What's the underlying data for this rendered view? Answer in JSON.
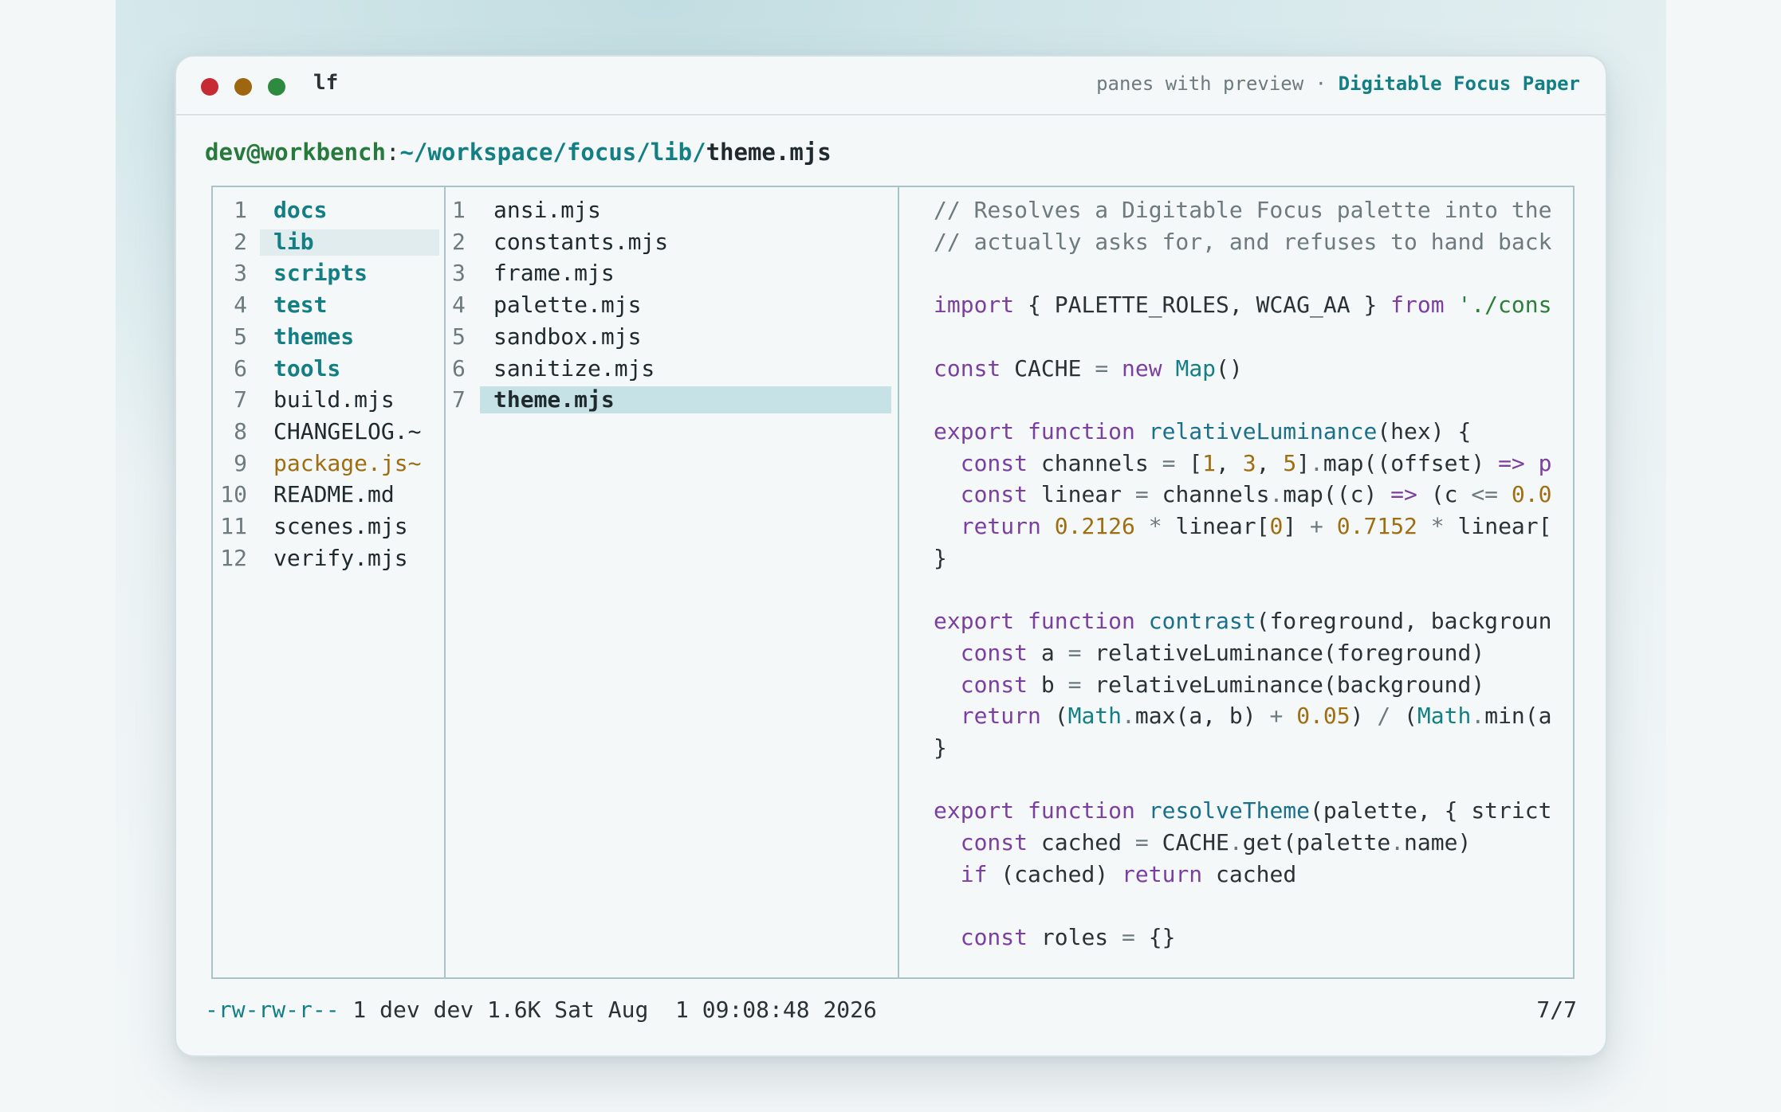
{
  "window": {
    "app_title": "lf",
    "subtitle": "panes with preview",
    "separator": "·",
    "theme_name": "Digitable Focus Paper"
  },
  "prompt": {
    "user_host": "dev@workbench",
    "colon": ":",
    "dir_path": "~/workspace/focus/lib/",
    "file": "theme.mjs"
  },
  "parent_pane": {
    "items": [
      {
        "num": "1",
        "name": "docs",
        "kind": "dir"
      },
      {
        "num": "2",
        "name": "lib",
        "kind": "dir",
        "current": true
      },
      {
        "num": "3",
        "name": "scripts",
        "kind": "dir"
      },
      {
        "num": "4",
        "name": "test",
        "kind": "dir"
      },
      {
        "num": "5",
        "name": "themes",
        "kind": "dir"
      },
      {
        "num": "6",
        "name": "tools",
        "kind": "dir"
      },
      {
        "num": "7",
        "name": "build.mjs",
        "kind": "file"
      },
      {
        "num": "8",
        "name": "CHANGELOG.~",
        "kind": "file"
      },
      {
        "num": "9",
        "name": "package.js~",
        "kind": "modified"
      },
      {
        "num": "10",
        "name": "README.md",
        "kind": "file"
      },
      {
        "num": "11",
        "name": "scenes.mjs",
        "kind": "file"
      },
      {
        "num": "12",
        "name": "verify.mjs",
        "kind": "file"
      }
    ]
  },
  "current_pane": {
    "items": [
      {
        "num": "1",
        "name": "ansi.mjs"
      },
      {
        "num": "2",
        "name": "constants.mjs"
      },
      {
        "num": "3",
        "name": "frame.mjs"
      },
      {
        "num": "4",
        "name": "palette.mjs"
      },
      {
        "num": "5",
        "name": "sandbox.mjs"
      },
      {
        "num": "6",
        "name": "sanitize.mjs"
      },
      {
        "num": "7",
        "name": "theme.mjs",
        "selected": true
      }
    ]
  },
  "preview": {
    "lines": [
      [
        [
          "c-com",
          "// Resolves a Digitable Focus palette into the"
        ]
      ],
      [
        [
          "c-com",
          "// actually asks for, and refuses to hand back"
        ]
      ],
      [],
      [
        [
          "c-kw",
          "import"
        ],
        [
          "",
          " { PALETTE_ROLES, WCAG_AA } "
        ],
        [
          "c-kw",
          "from"
        ],
        [
          "",
          " "
        ],
        [
          "c-str",
          "'./cons"
        ]
      ],
      [],
      [
        [
          "c-kw",
          "const"
        ],
        [
          "",
          " CACHE "
        ],
        [
          "c-op",
          "="
        ],
        [
          "",
          " "
        ],
        [
          "c-kw",
          "new"
        ],
        [
          "",
          " "
        ],
        [
          "c-ty",
          "Map"
        ],
        [
          "",
          "()"
        ]
      ],
      [],
      [
        [
          "c-kw",
          "export"
        ],
        [
          "",
          " "
        ],
        [
          "c-kw",
          "function"
        ],
        [
          "",
          " "
        ],
        [
          "c-fn",
          "relativeLuminance"
        ],
        [
          "",
          "(hex) {"
        ]
      ],
      [
        [
          "",
          "  "
        ],
        [
          "c-kw",
          "const"
        ],
        [
          "",
          " channels "
        ],
        [
          "c-op",
          "="
        ],
        [
          "",
          " ["
        ],
        [
          "c-num",
          "1"
        ],
        [
          "",
          ", "
        ],
        [
          "c-num",
          "3"
        ],
        [
          "",
          ", "
        ],
        [
          "c-num",
          "5"
        ],
        [
          "",
          "]"
        ],
        [
          "c-op",
          "."
        ],
        [
          "",
          "map((offset) "
        ],
        [
          "c-kw",
          "=>"
        ],
        [
          "",
          " "
        ],
        [
          "c-kw",
          "p"
        ]
      ],
      [
        [
          "",
          "  "
        ],
        [
          "c-kw",
          "const"
        ],
        [
          "",
          " linear "
        ],
        [
          "c-op",
          "="
        ],
        [
          "",
          " channels"
        ],
        [
          "c-op",
          "."
        ],
        [
          "",
          "map((c) "
        ],
        [
          "c-kw",
          "=>"
        ],
        [
          "",
          " (c "
        ],
        [
          "c-op",
          "<="
        ],
        [
          "",
          " "
        ],
        [
          "c-num",
          "0.0"
        ]
      ],
      [
        [
          "",
          "  "
        ],
        [
          "c-kw",
          "return"
        ],
        [
          "",
          " "
        ],
        [
          "c-num",
          "0.2126"
        ],
        [
          "",
          " "
        ],
        [
          "c-op",
          "*"
        ],
        [
          "",
          " linear["
        ],
        [
          "c-num",
          "0"
        ],
        [
          "",
          "] "
        ],
        [
          "c-op",
          "+"
        ],
        [
          "",
          " "
        ],
        [
          "c-num",
          "0.7152"
        ],
        [
          "",
          " "
        ],
        [
          "c-op",
          "*"
        ],
        [
          "",
          " linear["
        ]
      ],
      [
        [
          "",
          "}"
        ]
      ],
      [],
      [
        [
          "c-kw",
          "export"
        ],
        [
          "",
          " "
        ],
        [
          "c-kw",
          "function"
        ],
        [
          "",
          " "
        ],
        [
          "c-fn",
          "contrast"
        ],
        [
          "",
          "(foreground, backgroun"
        ]
      ],
      [
        [
          "",
          "  "
        ],
        [
          "c-kw",
          "const"
        ],
        [
          "",
          " a "
        ],
        [
          "c-op",
          "="
        ],
        [
          "",
          " relativeLuminance(foreground)"
        ]
      ],
      [
        [
          "",
          "  "
        ],
        [
          "c-kw",
          "const"
        ],
        [
          "",
          " b "
        ],
        [
          "c-op",
          "="
        ],
        [
          "",
          " relativeLuminance(background)"
        ]
      ],
      [
        [
          "",
          "  "
        ],
        [
          "c-kw",
          "return"
        ],
        [
          "",
          " ("
        ],
        [
          "c-ty",
          "Math"
        ],
        [
          "c-op",
          "."
        ],
        [
          "",
          "max(a, b) "
        ],
        [
          "c-op",
          "+"
        ],
        [
          "",
          " "
        ],
        [
          "c-num",
          "0.05"
        ],
        [
          "",
          ") "
        ],
        [
          "c-op",
          "/"
        ],
        [
          "",
          " ("
        ],
        [
          "c-ty",
          "Math"
        ],
        [
          "c-op",
          "."
        ],
        [
          "",
          "min(a"
        ]
      ],
      [
        [
          "",
          "}"
        ]
      ],
      [],
      [
        [
          "c-kw",
          "export"
        ],
        [
          "",
          " "
        ],
        [
          "c-kw",
          "function"
        ],
        [
          "",
          " "
        ],
        [
          "c-fn",
          "resolveTheme"
        ],
        [
          "",
          "(palette, { strict"
        ]
      ],
      [
        [
          "",
          "  "
        ],
        [
          "c-kw",
          "const"
        ],
        [
          "",
          " cached "
        ],
        [
          "c-op",
          "="
        ],
        [
          "",
          " CACHE"
        ],
        [
          "c-op",
          "."
        ],
        [
          "",
          "get(palette"
        ],
        [
          "c-op",
          "."
        ],
        [
          "",
          "name)"
        ]
      ],
      [
        [
          "",
          "  "
        ],
        [
          "c-kw",
          "if"
        ],
        [
          "",
          " (cached) "
        ],
        [
          "c-kw",
          "return"
        ],
        [
          "",
          " cached"
        ]
      ],
      [],
      [
        [
          "",
          "  "
        ],
        [
          "c-kw",
          "const"
        ],
        [
          "",
          " roles "
        ],
        [
          "c-op",
          "="
        ],
        [
          "",
          " {}"
        ]
      ]
    ]
  },
  "status": {
    "perms": "-rw-rw-r--",
    "details": " 1 dev dev 1.6K Sat Aug  1 09:08:48 2026",
    "position": "7/7"
  }
}
